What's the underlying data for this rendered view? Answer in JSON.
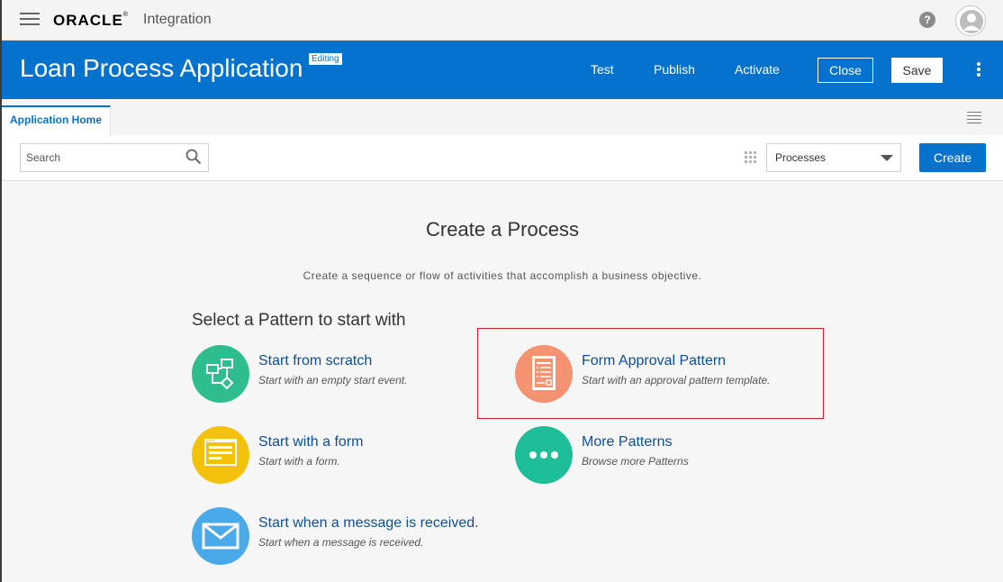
{
  "topbar": {
    "logo_text": "ORACLE",
    "logo_mark": "®",
    "product_name": "Integration",
    "help_label": "?"
  },
  "appbar": {
    "title": "Loan Process Application",
    "badge": "Editing",
    "actions": [
      "Test",
      "Publish",
      "Activate"
    ],
    "close_label": "Close",
    "save_label": "Save"
  },
  "tabs": {
    "items": [
      {
        "label": "Application Home",
        "active": true
      }
    ]
  },
  "toolbar": {
    "search_placeholder": "Search",
    "type_select_value": "Processes",
    "create_label": "Create"
  },
  "main": {
    "title": "Create a Process",
    "subtitle": "Create a sequence or flow of activities that accomplish a business objective.",
    "section_heading": "Select a Pattern to start with",
    "patterns": [
      {
        "title": "Start from scratch",
        "description": "Start with an empty start event.",
        "icon": "flow-diagram-icon",
        "color": "#2dbd8e"
      },
      {
        "title": "Form Approval Pattern",
        "description": "Start with an approval pattern template.",
        "icon": "form-document-icon",
        "color": "#f59272",
        "highlighted": true
      },
      {
        "title": "Start with a form",
        "description": "Start with a form.",
        "icon": "web-form-icon",
        "color": "#f4c20d"
      },
      {
        "title": "More Patterns",
        "description": "Browse more Patterns",
        "icon": "more-dots-icon",
        "color": "#1ebe99"
      },
      {
        "title": "Start when a message is received.",
        "description": "Start when a message is received.",
        "icon": "envelope-icon",
        "color": "#4aa9e8"
      }
    ]
  },
  "colors": {
    "brand_blue": "#0572ce",
    "highlight_red": "#d0202a",
    "link_blue": "#0b4f99"
  }
}
